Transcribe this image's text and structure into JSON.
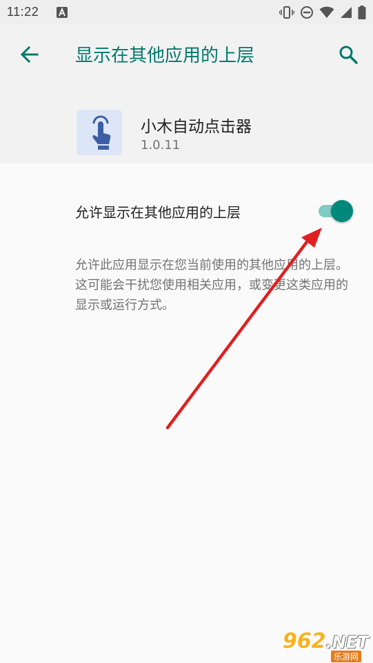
{
  "status_bar": {
    "time": "11:22",
    "icons": [
      "notification-a-icon",
      "vibrate-icon",
      "dnd-icon",
      "wifi-icon",
      "signal-icon",
      "battery-icon"
    ]
  },
  "app_bar": {
    "title": "显示在其他应用的上层",
    "accent_color": "#00796b",
    "icons": [
      "back-arrow-icon",
      "search-icon"
    ]
  },
  "app_info": {
    "name": "小木自动点击器",
    "version": "1.0.11",
    "icon": "tap-hand-icon"
  },
  "setting": {
    "label": "允许显示在其他应用的上层",
    "enabled": true,
    "toggle_color": "#00897b"
  },
  "description": "允许此应用显示在您当前使用的其他应用的上层。这可能会干扰您使用相关应用，或变更这类应用的显示或运行方式。",
  "annotation": {
    "arrow_color": "#e02020"
  },
  "watermark": {
    "number": "962",
    "suffix": ".NET",
    "subtitle": "乐游网"
  }
}
